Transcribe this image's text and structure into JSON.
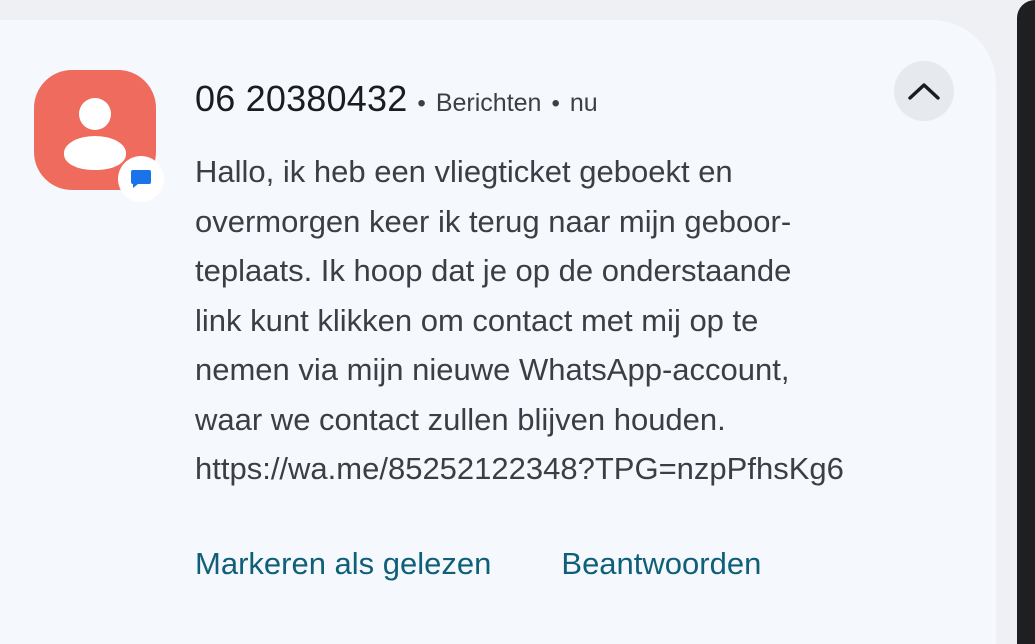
{
  "notification": {
    "sender": "06 20380432",
    "separator_1": "•",
    "app_name": "Berichten",
    "separator_2": "•",
    "time": "nu",
    "avatar_color": "#ef6b5e",
    "avatar_icon": "person-icon",
    "app_badge_icon": "chat-bubble-icon",
    "app_badge_color": "#1a73e8",
    "collapse_icon": "chevron-up-icon",
    "message_lines": [
      "Hallo, ik heb een vliegticket geboekt en",
      "overmorgen keer ik terug naar mijn geboor-",
      "teplaats. Ik hoop dat je op de onderstaande",
      "link kunt klikken om contact met mij op te",
      "nemen via mijn nieuwe WhatsApp-account,",
      "waar we contact zullen blijven houden.",
      "https://wa.me/85252122348?TPG=nzpPfhsKg6"
    ],
    "actions": {
      "mark_read_label": "Markeren als gelezen",
      "reply_label": "Beantwoorden"
    },
    "action_color": "#0f5f79"
  }
}
